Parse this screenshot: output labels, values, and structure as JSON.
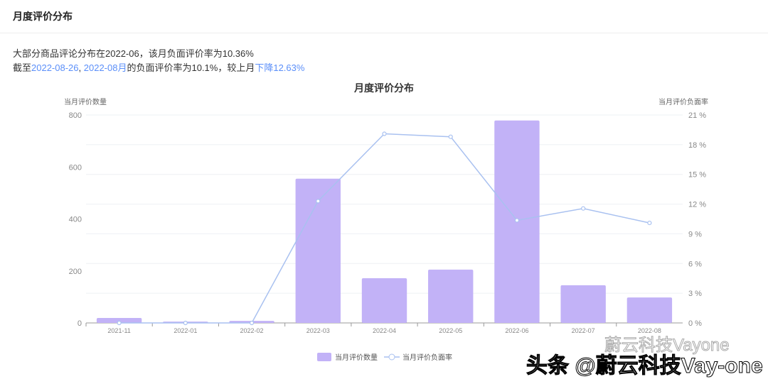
{
  "header": {
    "title": "月度评价分布"
  },
  "summary": {
    "line1": "大部分商品评论分布在2022-06，该月负面评价率为10.36%",
    "line2_a": "截至",
    "line2_date": "2022-08-26",
    "line2_sep": ", ",
    "line2_month": "2022-08月",
    "line2_b": "的负面评价率为10.1%，较上月",
    "line2_change": "下降12.63%"
  },
  "watermark": {
    "line1": "蔚云科技Vayone",
    "line2": "头条 @蔚云科技Vay-one"
  },
  "colors": {
    "bar": "#c2b2f7",
    "line": "#a9c1f0",
    "highlight": "#5b8ff9"
  },
  "chart_data": {
    "type": "bar+line",
    "title": "月度评价分布",
    "ylabel_left": "当月评价数量",
    "ylabel_right": "当月评价负面率",
    "categories": [
      "2021-11",
      "2022-01",
      "2022-02",
      "2022-03",
      "2022-04",
      "2022-05",
      "2022-06",
      "2022-07",
      "2022-08"
    ],
    "ylim_left": [
      0,
      800
    ],
    "yticks_left": [
      "0",
      "200",
      "400",
      "600",
      "800"
    ],
    "ylim_right": [
      0,
      21
    ],
    "yticks_right": [
      "0 %",
      "3 %",
      "6 %",
      "9 %",
      "12 %",
      "15 %",
      "18 %",
      "21 %"
    ],
    "series": [
      {
        "name": "当月评价数量",
        "type": "bar",
        "values": [
          19,
          5,
          8,
          555,
          172,
          205,
          779,
          145,
          98
        ]
      },
      {
        "name": "当月评价负面率",
        "type": "line",
        "values": [
          0,
          0,
          0,
          12.3,
          19.1,
          18.8,
          10.36,
          11.56,
          10.1
        ]
      }
    ],
    "legend": "bottom-center",
    "grid": true
  }
}
